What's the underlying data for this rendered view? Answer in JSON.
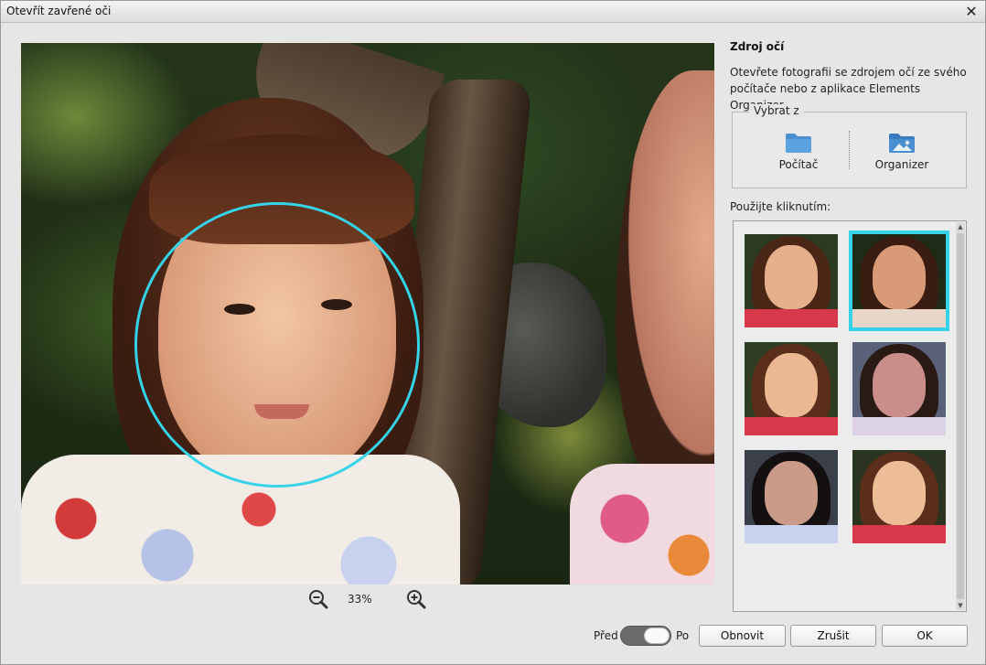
{
  "window": {
    "title": "Otevřít zavřené oči",
    "close_glyph": "✕"
  },
  "zoom": {
    "value": "33%",
    "out_icon": "zoom-out-icon",
    "in_icon": "zoom-in-icon"
  },
  "sidebar": {
    "heading": "Zdroj očí",
    "description": "Otevřete fotografii se zdrojem očí ze svého počítače nebo z aplikace Elements Organizer",
    "group_label": "Vybrat z",
    "sources": [
      {
        "label": "Počítač",
        "icon": "folder-icon"
      },
      {
        "label": "Organizer",
        "icon": "image-folder-icon"
      }
    ],
    "use_label": "Použijte kliknutím:",
    "thumbnails": [
      {
        "selected": false,
        "bg": "#2b3a20",
        "hair": "#4a2616",
        "face": "#e7b08c",
        "kimono": "#d8394a"
      },
      {
        "selected": true,
        "bg": "#1f2b16",
        "hair": "#3a1c10",
        "face": "#d99a78",
        "kimono": "#e8d7c8"
      },
      {
        "selected": false,
        "bg": "#2f3d22",
        "hair": "#5a2e1a",
        "face": "#ebb894",
        "kimono": "#d8394a"
      },
      {
        "selected": false,
        "bg": "#5a627a",
        "hair": "#2a1a14",
        "face": "#c98e8a",
        "kimono": "#dcd2e6"
      },
      {
        "selected": false,
        "bg": "#3a3f4a",
        "hair": "#141010",
        "face": "#c99b88",
        "kimono": "#c8d2ef"
      },
      {
        "selected": false,
        "bg": "#2a3420",
        "hair": "#5a2e1a",
        "face": "#edbd98",
        "kimono": "#d8394a"
      }
    ]
  },
  "footer": {
    "before_label": "Před",
    "after_label": "Po",
    "toggle_on": true,
    "reset_label": "Obnovit",
    "cancel_label": "Zrušit",
    "ok_label": "OK"
  },
  "colors": {
    "accent": "#35d3e8",
    "folder": "#4a8fd0"
  }
}
